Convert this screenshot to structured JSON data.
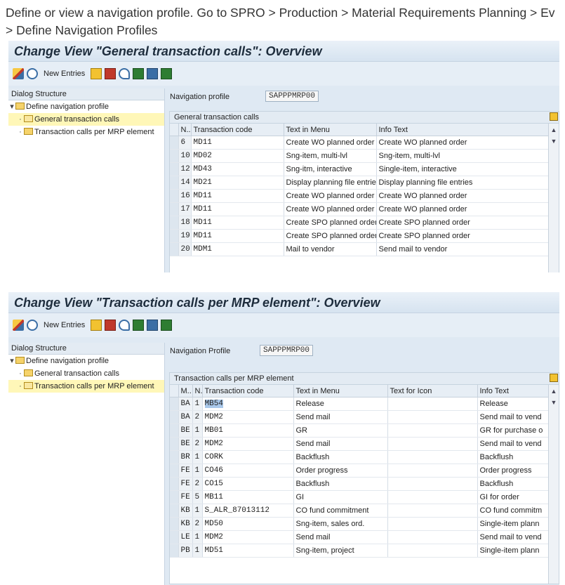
{
  "intro": {
    "line1": "Define or view a navigation profile. Go to SPRO > Production > Material Requirements Planning > Ev",
    "line2": "> Define Navigation Profiles"
  },
  "toolbar": {
    "new_entries": "New Entries"
  },
  "dialog": {
    "header": "Dialog Structure",
    "root": "Define navigation profile",
    "child1": "General transaction calls",
    "child2": "Transaction calls per MRP element"
  },
  "screen1": {
    "title": "Change View \"General transaction calls\": Overview",
    "nav_label": "Navigation profile",
    "nav_value": "SAPPPMRP00",
    "grid_title": "General transaction calls",
    "columns": [
      "N..",
      "Transaction code",
      "Text in Menu",
      "Info Text"
    ],
    "rows": [
      {
        "n": "6",
        "code": "MD11",
        "menu": "Create WO planned order",
        "info": "Create WO planned order"
      },
      {
        "n": "10",
        "code": "MD02",
        "menu": "Sng-item, multi-lvl",
        "info": "Sng-item, multi-lvl"
      },
      {
        "n": "12",
        "code": "MD43",
        "menu": "Sng-itm, interactive",
        "info": "Single-item, interactive"
      },
      {
        "n": "14",
        "code": "MD21",
        "menu": "Display planning file entries",
        "info": "Display planning file entries"
      },
      {
        "n": "16",
        "code": "MD11",
        "menu": "Create WO planned order",
        "info": "Create WO planned order"
      },
      {
        "n": "17",
        "code": "MD11",
        "menu": "Create WO planned order",
        "info": "Create WO planned order"
      },
      {
        "n": "18",
        "code": "MD11",
        "menu": "Create SPO planned order",
        "info": "Create SPO planned order"
      },
      {
        "n": "19",
        "code": "MD11",
        "menu": "Create SPO planned order",
        "info": "Create SPO planned order"
      },
      {
        "n": "20",
        "code": "MDM1",
        "menu": "Mail to vendor",
        "info": "Send mail to vendor"
      }
    ]
  },
  "screen2": {
    "title": "Change View \"Transaction calls per MRP element\": Overview",
    "nav_label": "Navigation Profile",
    "nav_value": "SAPPPMRP00",
    "grid_title": "Transaction calls per MRP element",
    "columns": [
      "M..",
      "N..",
      "Transaction code",
      "Text in Menu",
      "Text for Icon",
      "Info Text"
    ],
    "rows": [
      {
        "m": "BA",
        "n": "1",
        "code": "MB54",
        "menu": "Release",
        "icon": "",
        "info": "Release"
      },
      {
        "m": "BA",
        "n": "2",
        "code": "MDM2",
        "menu": "Send mail",
        "icon": "",
        "info": "Send mail to vend"
      },
      {
        "m": "BE",
        "n": "1",
        "code": "MB01",
        "menu": "GR",
        "icon": "",
        "info": "GR for purchase o"
      },
      {
        "m": "BE",
        "n": "2",
        "code": "MDM2",
        "menu": "Send mail",
        "icon": "",
        "info": "Send mail to vend"
      },
      {
        "m": "BR",
        "n": "1",
        "code": "CORK",
        "menu": "Backflush",
        "icon": "",
        "info": "Backflush"
      },
      {
        "m": "FE",
        "n": "1",
        "code": "CO46",
        "menu": "Order progress",
        "icon": "",
        "info": "Order progress"
      },
      {
        "m": "FE",
        "n": "2",
        "code": "CO15",
        "menu": "Backflush",
        "icon": "",
        "info": "Backflush"
      },
      {
        "m": "FE",
        "n": "5",
        "code": "MB11",
        "menu": "GI",
        "icon": "",
        "info": "GI for order"
      },
      {
        "m": "KB",
        "n": "1",
        "code": "S_ALR_87013112",
        "menu": "CO fund commitment",
        "icon": "",
        "info": "CO fund commitm"
      },
      {
        "m": "KB",
        "n": "2",
        "code": "MD50",
        "menu": "Sng-item, sales ord.",
        "icon": "",
        "info": "Single-item plann"
      },
      {
        "m": "LE",
        "n": "1",
        "code": "MDM2",
        "menu": "Send mail",
        "icon": "",
        "info": "Send mail to vend"
      },
      {
        "m": "PB",
        "n": "1",
        "code": "MD51",
        "menu": "Sng-item, project",
        "icon": "",
        "info": "Single-item plann"
      }
    ]
  },
  "colors": {
    "panel": "#dfe9f3",
    "tree_selected": "#fff7b8",
    "highlight": "#a9c8ea"
  }
}
